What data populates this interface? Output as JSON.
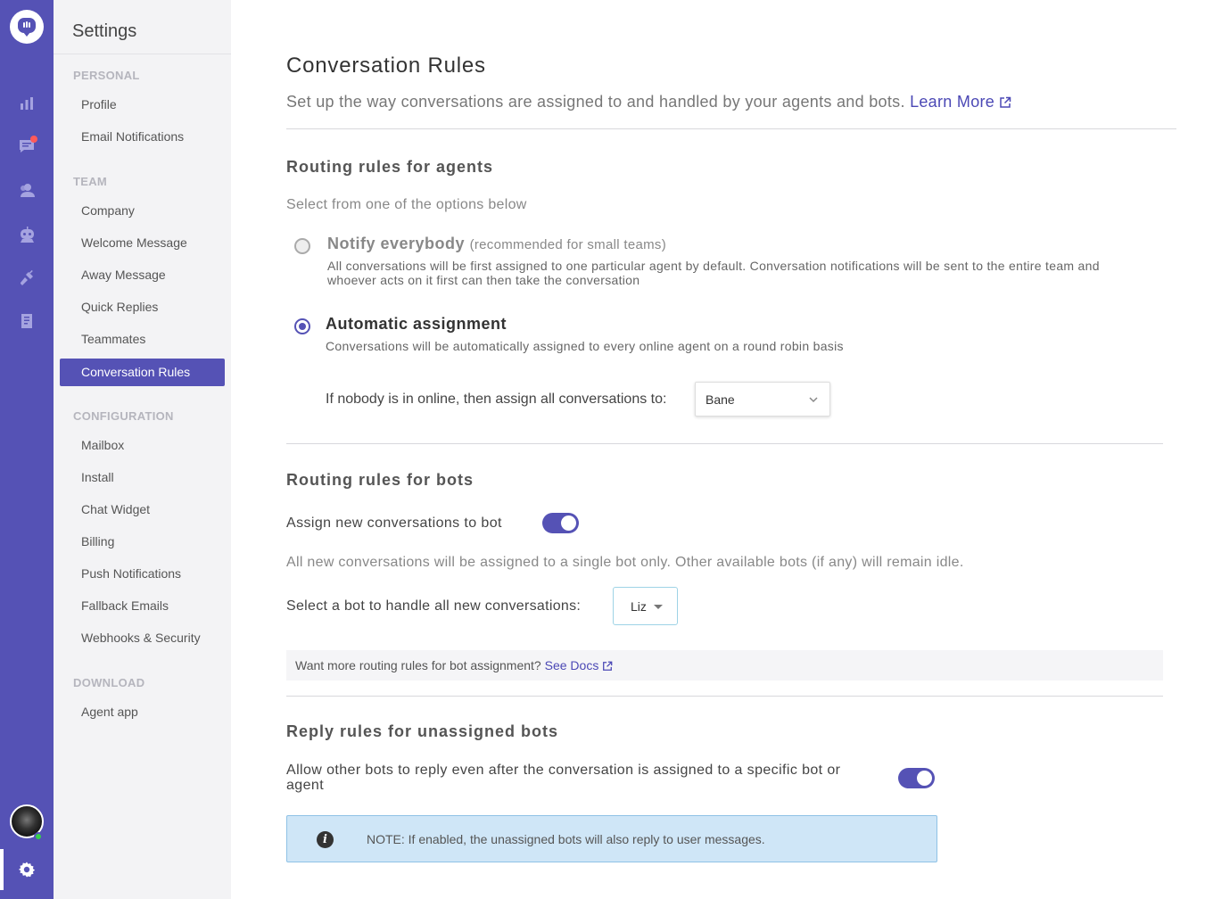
{
  "rail": {
    "icons": [
      "logo-icon",
      "analytics-icon",
      "conversations-icon",
      "contacts-icon",
      "bots-icon",
      "integrations-icon",
      "knowledge-base-icon",
      "avatar",
      "settings-icon"
    ],
    "accent_color": "#5552b5",
    "notification_color": "#ff5a5a",
    "online_color": "#35d04a"
  },
  "sidebar": {
    "title": "Settings",
    "sections": {
      "personal": "PERSONAL",
      "team": "TEAM",
      "configuration": "CONFIGURATION",
      "download": "DOWNLOAD"
    },
    "items": {
      "profile": "Profile",
      "email_notifications": "Email Notifications",
      "company": "Company",
      "welcome_message": "Welcome Message",
      "away_message": "Away Message",
      "quick_replies": "Quick Replies",
      "teammates": "Teammates",
      "conversation_rules": "Conversation Rules",
      "mailbox": "Mailbox",
      "install": "Install",
      "chat_widget": "Chat Widget",
      "billing": "Billing",
      "push_notifications": "Push Notifications",
      "fallback_emails": "Fallback Emails",
      "webhooks_security": "Webhooks & Security",
      "agent_app": "Agent app"
    },
    "active_item": "Conversation Rules"
  },
  "main": {
    "title": "Conversation Rules",
    "subtitle": "Set up the way conversations are assigned to and handled by your agents and bots.",
    "learn_more": "Learn More",
    "agents": {
      "heading": "Routing rules for agents",
      "hint": "Select from one of the options below",
      "notify": {
        "title": "Notify everybody",
        "note": "(recommended for small teams)",
        "description": "All conversations will be first assigned to one particular agent by default. Conversation notifications will be sent to the entire team and whoever acts on it first can then take the conversation",
        "selected": false
      },
      "automatic": {
        "title": "Automatic assignment",
        "description": "Conversations will be automatically assigned to every online agent on a round robin basis",
        "selected": true
      },
      "fallback_label": "If nobody is in online, then assign all conversations to:",
      "fallback_value": "Bane"
    },
    "bots": {
      "heading": "Routing rules for bots",
      "assign_label": "Assign new conversations to bot",
      "assign_enabled": true,
      "info": "All new conversations will be assigned to a single bot only. Other available bots (if any) will remain idle.",
      "select_label": "Select a bot to handle all new conversations:",
      "select_value": "Liz",
      "docs_text": "Want more routing rules for bot assignment?",
      "docs_link": "See Docs"
    },
    "unassigned": {
      "heading": "Reply rules for unassigned bots",
      "allow_label": "Allow other bots to reply even after the conversation is assigned to a specific bot or agent",
      "allow_enabled": true,
      "note": "NOTE: If enabled, the unassigned bots will also reply to user messages."
    }
  }
}
